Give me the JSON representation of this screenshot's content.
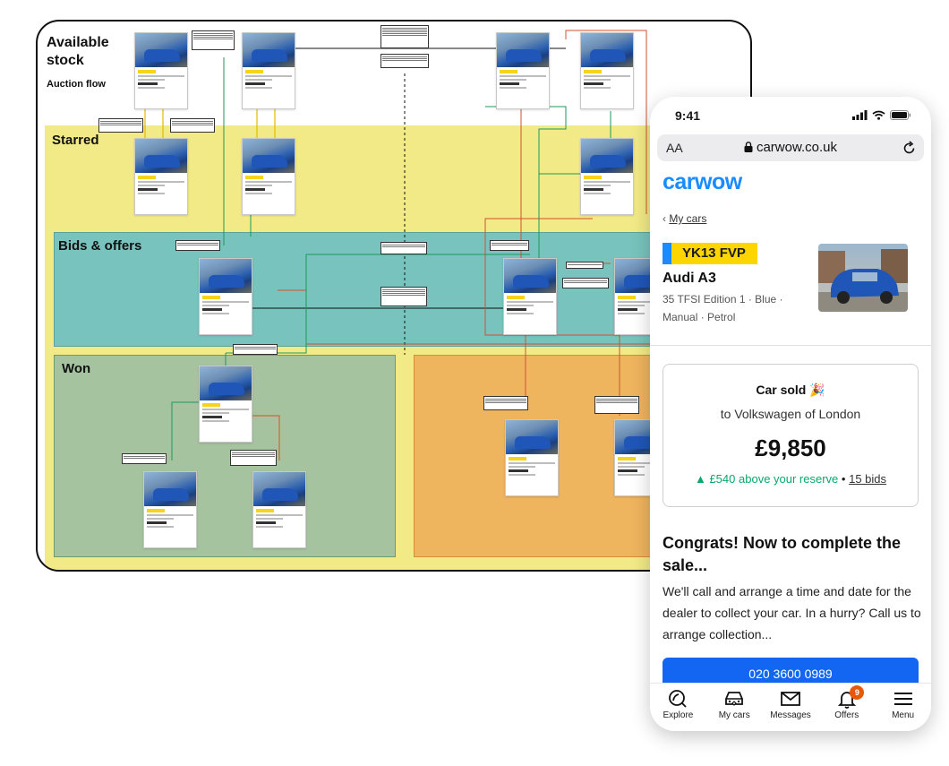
{
  "board": {
    "title": "Available\nstock",
    "subtitle": "Auction flow",
    "lanes": {
      "starred": "Starred",
      "bids": "Bids & offers",
      "won": "Won"
    }
  },
  "phone": {
    "status_time": "9:41",
    "browser": {
      "text_size": "AA",
      "url": "carwow.co.uk"
    },
    "brand": "carwow",
    "back_label": "My cars",
    "vehicle": {
      "plate": "YK13 FVP",
      "name": "Audi A3",
      "description": "35 TFSI Edition 1 · Blue · Manual · Petrol"
    },
    "sale": {
      "title": "Car sold",
      "to": "to Volkswagen of London",
      "price": "£9,850",
      "above_amount": "▲ £540",
      "above_text": "above your reserve",
      "separator": "•",
      "bids": "15 bids"
    },
    "congrats_title": "Congrats! Now to complete the sale...",
    "congrats_body": "We'll call and arrange a time and date for the dealer to collect your car. In a hurry? Call us to arrange collection...",
    "call_button": "020 3600 0989",
    "tabs": [
      {
        "label": "Explore",
        "icon": "compass-icon"
      },
      {
        "label": "My cars",
        "icon": "car-icon"
      },
      {
        "label": "Messages",
        "icon": "envelope-icon"
      },
      {
        "label": "Offers",
        "icon": "bell-icon",
        "badge": "9"
      },
      {
        "label": "Menu",
        "icon": "menu-icon"
      }
    ]
  },
  "colors": {
    "starred_lane": "#f2ea86",
    "bids_lane": "#78c3bd",
    "won_lane": "#a6c3a0",
    "lost_lane": "#efb45e",
    "brand_blue": "#1266f1",
    "plate_yellow": "#ffd500",
    "positive_green": "#0aa86a",
    "badge_orange": "#e8580c"
  }
}
